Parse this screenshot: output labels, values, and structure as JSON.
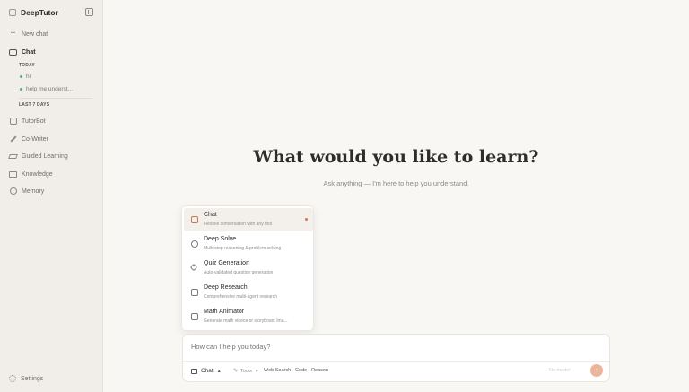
{
  "app": {
    "name": "DeepTutor"
  },
  "sidebar": {
    "new_chat": "New chat",
    "chat": "Chat",
    "sections": {
      "today": "TODAY",
      "last7": "LAST 7 DAYS"
    },
    "history_today": [
      "hi",
      "help me underst..."
    ],
    "items": [
      "TutorBot",
      "Co-Writer",
      "Guided Learning",
      "Knowledge",
      "Memory"
    ],
    "settings": "Settings"
  },
  "main": {
    "headline": "What would you like to learn?",
    "subline": "Ask anything — I'm here to help you understand."
  },
  "modes": [
    {
      "title": "Chat",
      "desc": "Flexible conversation with any tool",
      "selected": true
    },
    {
      "title": "Deep Solve",
      "desc": "Multi-step reasoning & problem solving",
      "selected": false
    },
    {
      "title": "Quiz Generation",
      "desc": "Auto-validated question generation",
      "selected": false
    },
    {
      "title": "Deep Research",
      "desc": "Comprehensive multi-agent research",
      "selected": false
    },
    {
      "title": "Math Animator",
      "desc": "Generate math videos or storyboard ima...",
      "selected": false
    }
  ],
  "composer": {
    "placeholder": "How can I help you today?",
    "mode_label": "Chat",
    "tools_label": "Tools",
    "tool_list": "Web Search · Code · Reason",
    "model_hint": "No model"
  },
  "colors": {
    "accent": "#d07a4a",
    "send_button": "#ecb59a",
    "status_dot": "#4caf7a"
  }
}
